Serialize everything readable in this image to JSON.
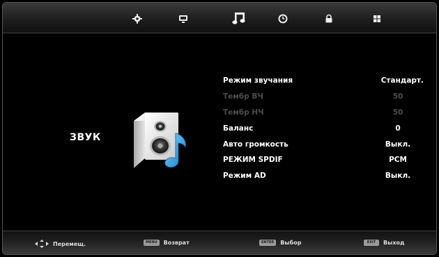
{
  "topbar": {
    "tabs": [
      {
        "name": "picture",
        "icon": "gear-icon",
        "active": false
      },
      {
        "name": "channel",
        "icon": "monitor-icon",
        "active": false
      },
      {
        "name": "sound",
        "icon": "music-note-icon",
        "active": true
      },
      {
        "name": "time",
        "icon": "clock-icon",
        "active": false
      },
      {
        "name": "lock",
        "icon": "lock-icon",
        "active": false
      },
      {
        "name": "options",
        "icon": "grid-icon",
        "active": false
      }
    ]
  },
  "section": {
    "title": "ЗВУК"
  },
  "menu": {
    "items": [
      {
        "label": "Режим звучания",
        "value": "Стандарт.",
        "enabled": true
      },
      {
        "label": "Тембр ВЧ",
        "value": "50",
        "enabled": false
      },
      {
        "label": "Тембр НЧ",
        "value": "50",
        "enabled": false
      },
      {
        "label": "Баланс",
        "value": "0",
        "enabled": true
      },
      {
        "label": "Авто громкость",
        "value": "Выкл.",
        "enabled": true
      },
      {
        "label": "РЕЖИМ SPDIF",
        "value": "PCM",
        "enabled": true
      },
      {
        "label": "Режим AD",
        "value": "Выкл.",
        "enabled": true
      }
    ]
  },
  "footer": {
    "move": {
      "label": "Перемещ."
    },
    "back": {
      "key": "MENU",
      "label": "Возврат"
    },
    "select": {
      "key": "ENTER",
      "label": "Выбор"
    },
    "exit": {
      "key": "EXIT",
      "label": "Выход"
    }
  },
  "colors": {
    "background": "#000000",
    "text": "#ffffff",
    "disabled_text": "#4c4c4c",
    "accent_blue": "#2a9fe0"
  }
}
